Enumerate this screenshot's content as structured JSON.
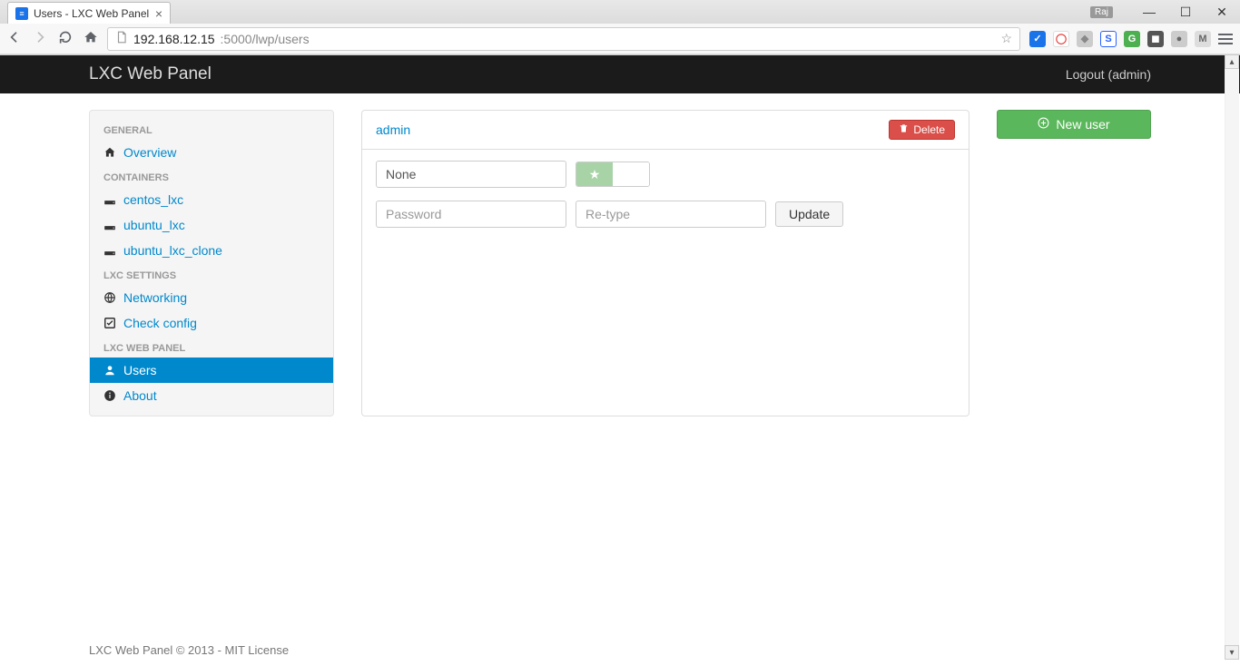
{
  "browser": {
    "tab_title": "Users - LXC Web Panel",
    "win_badge": "Raj",
    "url_host": "192.168.12.15",
    "url_rest": ":5000/lwp/users"
  },
  "navbar": {
    "brand": "LXC Web Panel",
    "logout": "Logout (admin)"
  },
  "sidebar": {
    "h_general": "GENERAL",
    "overview": "Overview",
    "h_containers": "CONTAINERS",
    "c1": "centos_lxc",
    "c2": "ubuntu_lxc",
    "c3": "ubuntu_lxc_clone",
    "h_settings": "LXC SETTINGS",
    "networking": "Networking",
    "check_config": "Check config",
    "h_panel": "LXC WEB PANEL",
    "users": "Users",
    "about": "About"
  },
  "panel": {
    "username": "admin",
    "delete_label": "Delete",
    "name_value": "None",
    "password_ph": "Password",
    "retype_ph": "Re-type",
    "update_label": "Update"
  },
  "actions": {
    "new_user": "New user"
  },
  "footer": {
    "text": "LXC Web Panel © 2013 - MIT License"
  }
}
